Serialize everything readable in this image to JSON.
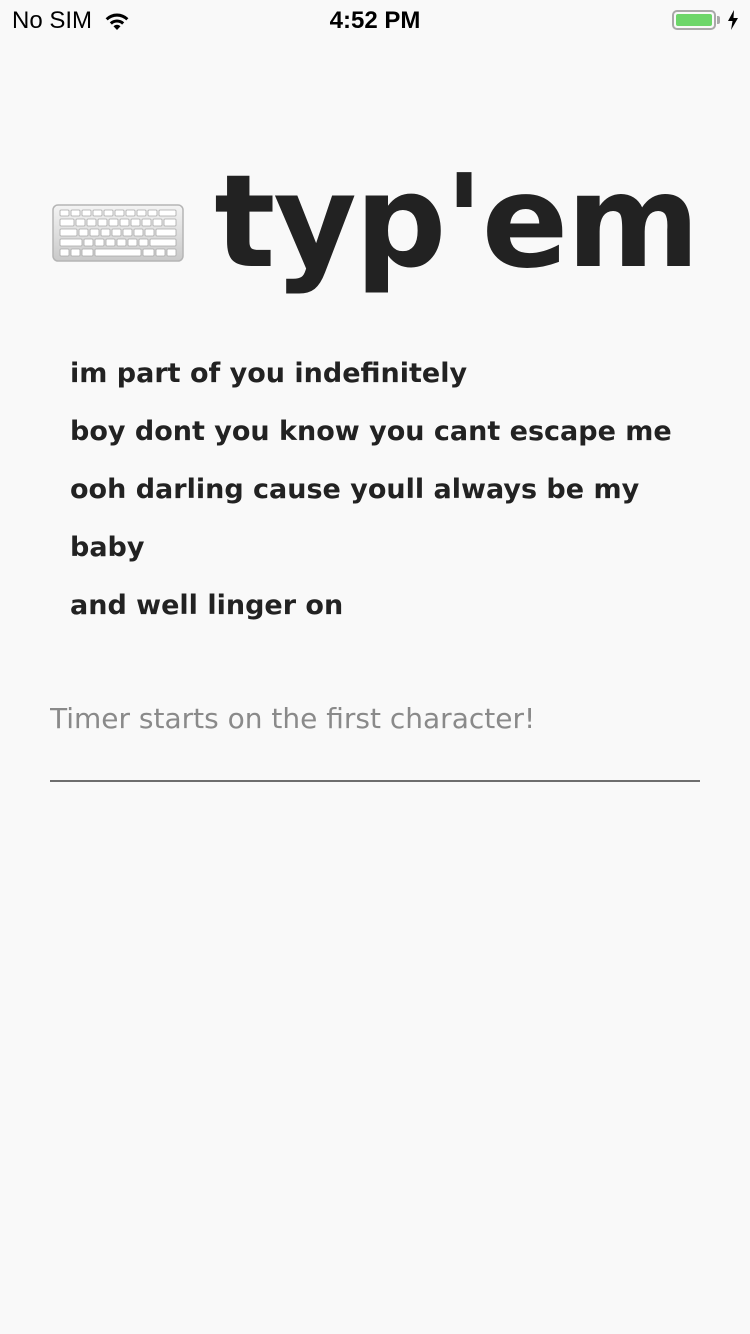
{
  "status_bar": {
    "carrier": "No SIM",
    "time": "4:52 PM",
    "wifi_icon": "wifi-icon",
    "battery_icon": "battery-icon",
    "charging_icon": "bolt-icon",
    "battery_level": 1.0,
    "battery_color": "#6dd66a"
  },
  "header": {
    "icon": "keyboard-icon",
    "title": "typ'em"
  },
  "prompt": {
    "lines": [
      "im part of you indefinitely",
      "boy dont you know you cant escape me",
      "ooh darling cause youll always be my",
      "baby",
      "and well linger on"
    ]
  },
  "input": {
    "value": "",
    "placeholder": "Timer starts on the first character!"
  }
}
